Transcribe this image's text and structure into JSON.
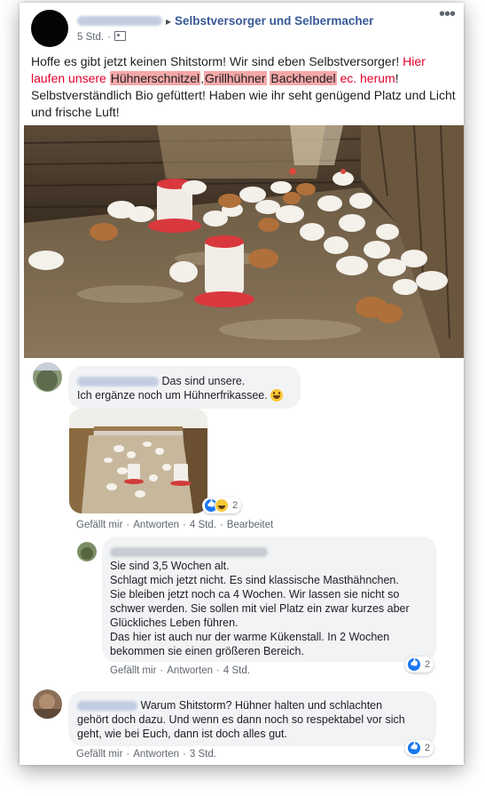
{
  "post": {
    "group_name": "Selbstversorger und Selbermacher",
    "time": "5 Std.",
    "text_before": "Hoffe es gibt jetzt keinen Shitstorm! Wir sind eben Selbstversorger! ",
    "text_red_1": "Hier laufen unsere ",
    "tag_1": "Hühnerschnitzel",
    "comma": ",",
    "tag_2": "Grillhühner",
    "space": " ",
    "tag_3": "Backhendel",
    "text_red_2": " ec. herum",
    "exclaim": "!",
    "text_after": " Selbstverständlich Bio gefüttert! Haben wie ihr seht genügend Platz und Licht und frische Luft!"
  },
  "comments": [
    {
      "line1": "Das sind unsere.",
      "line2": "Ich ergänze noch um Hühnerfrikassee.",
      "reaction_count": "2",
      "like": "Gefällt mir",
      "reply": "Antworten",
      "time": "4 Std.",
      "edited": "Bearbeitet"
    },
    {
      "lines": [
        "Sie sind 3,5 Wochen alt.",
        "Schlagt mich jetzt nicht. Es sind klassische Masthähnchen.",
        "Sie bleiben jetzt noch ca 4 Wochen. Wir lassen sie nicht so",
        "schwer werden. Sie sollen mit viel Platz ein zwar kurzes aber",
        "Glückliches Leben führen.",
        "Das hier ist auch nur der warme Kükenstall. In 2 Wochen",
        "bekommen sie einen größeren Bereich."
      ],
      "reaction_count": "2",
      "like": "Gefällt mir",
      "reply": "Antworten",
      "time": "4 Std."
    },
    {
      "lines": [
        "Warum Shitstorm? Hühner halten und schlachten",
        "gehört doch dazu. Und wenn es dann noch so respektabel vor sich",
        "geht, wie bei Euch, dann ist doch alles gut."
      ],
      "reaction_count": "2",
      "like": "Gefällt mir",
      "reply": "Antworten",
      "time": "3 Std."
    }
  ],
  "colors": {
    "link_blue": "#385898",
    "highlight": "#f5a8a8",
    "red_text": "#e4002b",
    "bubble_bg": "#f2f3f5",
    "like_blue": "#1877f2"
  },
  "icons": [
    "more-options-icon",
    "public-audience-icon",
    "like-reaction-icon",
    "haha-reaction-icon",
    "grinning-emoji-icon"
  ]
}
